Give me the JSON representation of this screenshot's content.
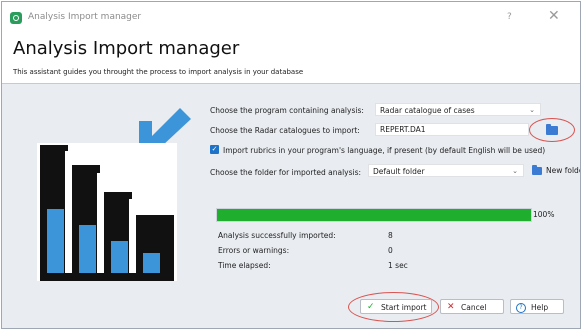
{
  "window": {
    "title": "Analysis Import manager",
    "help": "?",
    "close": "✕"
  },
  "header": {
    "title": "Analysis Import manager",
    "subtitle": "This assistant guides you throught the process to import analysis in your database"
  },
  "form": {
    "program_label": "Choose the program containing analysis:",
    "program_value": "Radar catalogue of cases",
    "catalogue_label": "Choose the Radar catalogues to import:",
    "catalogue_value": "REPERT.DA1",
    "rubrics_label": "Import rubrics in your program's language, if present (by default English will be used)",
    "rubrics_checked": true,
    "folder_label": "Choose the folder for imported analysis:",
    "folder_value": "Default folder",
    "new_folder_label": "New folder"
  },
  "progress": {
    "value": 100,
    "label": "100%"
  },
  "stats": {
    "imported_label": "Analysis successfully imported:",
    "imported_value": "8",
    "errors_label": "Errors or warnings:",
    "errors_value": "0",
    "elapsed_label": "Time elapsed:",
    "elapsed_value": "1 sec"
  },
  "buttons": {
    "start": "Start import",
    "cancel": "Cancel",
    "help": "Help"
  },
  "icons": {
    "chevron": "⌄",
    "check": "✓",
    "cancel_x": "✕",
    "help_q": "?"
  },
  "colors": {
    "accent": "#1e73c8",
    "progress": "#1fae2e",
    "highlight": "#d9534f",
    "chart_blue": "#3b95d8",
    "chart_black": "#111111"
  }
}
